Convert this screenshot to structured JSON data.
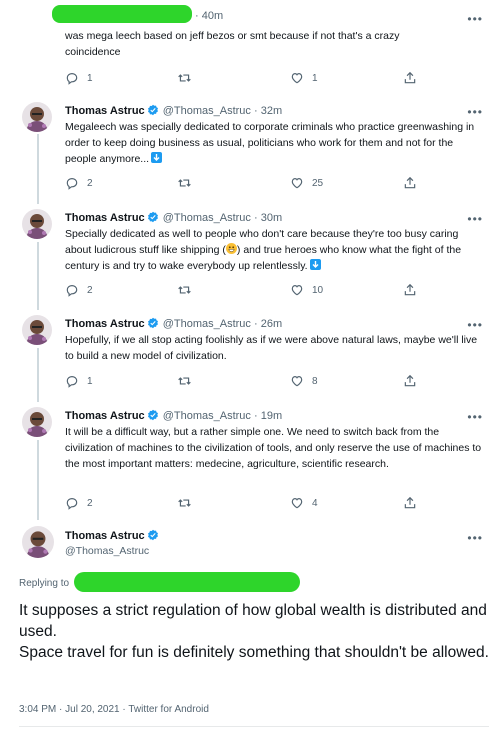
{
  "reply_tweet": {
    "time": "· 40m",
    "text": "was mega leech based on jeff bezos or smt because if not that's a crazy coincidence",
    "replies": "1",
    "likes": "1"
  },
  "thread": [
    {
      "name": "Thomas Astruc",
      "handle": "@Thomas_Astruc",
      "time": "· 32m",
      "text": "Megaleech was specially dedicated to corporate criminals who practice greenwashing in order to keep doing business as usual, politicians who work for them and not for the people anymore...",
      "replies": "2",
      "likes": "25"
    },
    {
      "name": "Thomas Astruc",
      "handle": "@Thomas_Astruc",
      "time": "· 30m",
      "text_a": "Specially dedicated as well to people who don't care because they're too busy caring about ludicrous stuff like shipping (",
      "text_b": ") and true heroes who know what the fight of the century is and try to wake everybody up relentlessly.",
      "replies": "2",
      "likes": "10"
    },
    {
      "name": "Thomas Astruc",
      "handle": "@Thomas_Astruc",
      "time": "· 26m",
      "text": "Hopefully, if we all stop acting foolishly as if we were above natural laws, maybe we'll live to build a new model of civilization.",
      "replies": "1",
      "likes": "8"
    },
    {
      "name": "Thomas Astruc",
      "handle": "@Thomas_Astruc",
      "time": "· 19m",
      "text": "It will be a difficult way, but a  rather simple one. We need to switch back from the civilization of machines to the civilization of tools, and only reserve the use of machines to the most important matters: medecine, agriculture, scientific research.",
      "replies": "2",
      "likes": "4"
    }
  ],
  "main_tweet": {
    "name": "Thomas Astruc",
    "handle": "@Thomas_Astruc",
    "replying_to": "Replying to",
    "text_line1": "It supposes a strict regulation of how global wealth is distributed and used.",
    "text_line2": "Space travel for fun is definitely something that shouldn't be allowed.",
    "footer": "3:04 PM · Jul 20, 2021 · Twitter for Android"
  },
  "colors": {
    "accent": "#1d9bf0",
    "redaction": "#2ed52b",
    "muted": "#536471"
  },
  "icons": [
    "reply-icon",
    "retweet-icon",
    "like-icon",
    "share-icon",
    "verified-badge-icon",
    "more-icon"
  ]
}
